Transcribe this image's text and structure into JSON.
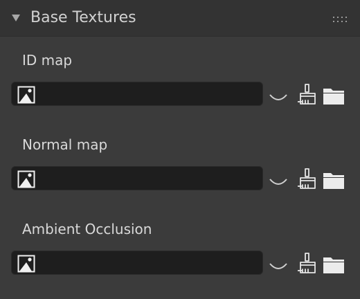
{
  "section": {
    "title": "Base Textures"
  },
  "slots": [
    {
      "label": "ID map"
    },
    {
      "label": "Normal map"
    },
    {
      "label": "Ambient Occlusion"
    }
  ],
  "icons": {
    "collapse": "triangle-down-icon",
    "drag": "drag-handle-icon",
    "thumbnail": "image-icon",
    "dropdown": "chevron-down-icon",
    "brush": "brush-icon",
    "folder": "folder-icon"
  },
  "colors": {
    "panel_bg": "#3b3b3b",
    "header_bg": "#333333",
    "field_bg": "#1e1e1e",
    "text": "#d9d9d9",
    "icon": "#e6e6e6"
  }
}
